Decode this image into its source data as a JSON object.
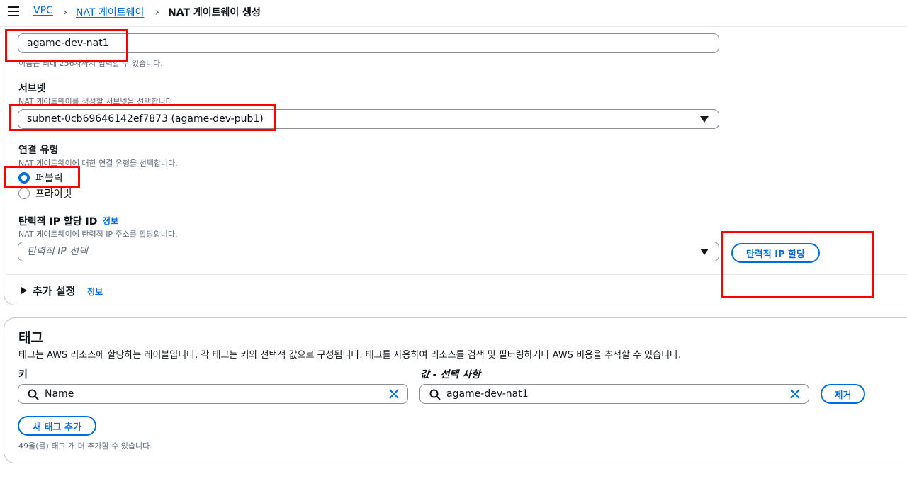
{
  "breadcrumb": {
    "items": [
      "VPC",
      "NAT 게이트웨이",
      "NAT 게이트웨이 생성"
    ]
  },
  "name_field": {
    "value": "agame-dev-nat1",
    "hint": "이름은 최대 256자까지 입력할 수 있습니다."
  },
  "subnet": {
    "label": "서브넷",
    "desc": "NAT 게이트웨이를 생성할 서브넷을 선택합니다.",
    "value": "subnet-0cb69646142ef7873 (agame-dev-pub1)"
  },
  "connection_type": {
    "label": "연결 유형",
    "desc": "NAT 게이트웨이에 대한 연결 유형을 선택합니다.",
    "options": [
      "퍼블릭",
      "프라이빗"
    ],
    "selected": "퍼블릭"
  },
  "eip": {
    "label": "탄력적 IP 할당 ID",
    "info": "정보",
    "desc": "NAT 게이트웨이에 탄력적 IP 주소를 할당합니다.",
    "placeholder": "탄력적 IP 선택",
    "button": "탄력적 IP 할당"
  },
  "additional": {
    "label": "추가 설정",
    "info": "정보"
  },
  "tags": {
    "title": "태그",
    "desc": "태그는 AWS 리소스에 할당하는 레이블입니다. 각 태그는 키와 선택적 값으로 구성됩니다. 태그를 사용하여 리소스를 검색 및 필터링하거나 AWS 비용을 추적할 수 있습니다.",
    "key_label": "키",
    "value_label": "값 - 선택 사항",
    "key_value": "Name",
    "value_value": "agame-dev-nat1",
    "remove_button": "제거",
    "add_button": "새 태그 추가",
    "remaining": "49을(를) 태그.개 더 추가할 수 있습니다."
  },
  "colors": {
    "link": "#006ce0",
    "annotation": "#ff0000"
  }
}
